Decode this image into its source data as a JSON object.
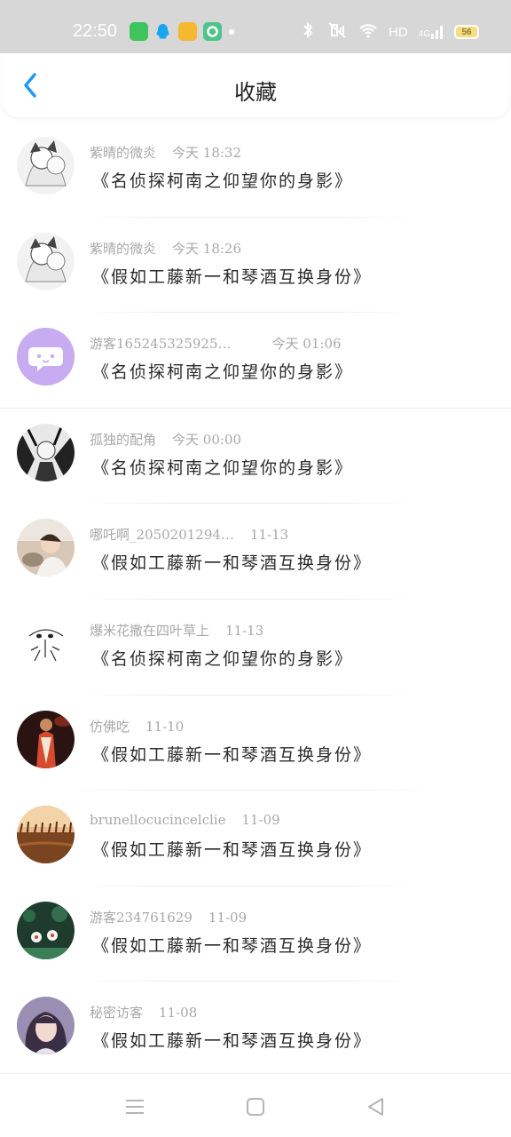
{
  "status": {
    "time": "22:50",
    "network": "HD",
    "signal": "4G",
    "battery": "56"
  },
  "header": {
    "title": "收藏"
  },
  "favorites": [
    {
      "user": "紫晴的微炎",
      "time": "今天 18:32",
      "title": "《名侦探柯南之仰望你的身影》",
      "avatar": "anime-sketch-avatar"
    },
    {
      "user": "紫晴的微炎",
      "time": "今天 18:26",
      "title": "《假如工藤新一和琴酒互换身份》",
      "avatar": "anime-sketch-avatar"
    },
    {
      "user": "游客165245325925…",
      "time": "今天 01:06",
      "title": "《名侦探柯南之仰望你的身影》",
      "avatar": "default-chat-avatar"
    },
    {
      "user": "孤独的配角",
      "time": "今天 00:00",
      "title": "《名侦探柯南之仰望你的身影》",
      "avatar": "anime-dark-avatar"
    },
    {
      "user": "哪吒啊_2050201294…",
      "time": "11-13",
      "title": "《假如工藤新一和琴酒互换身份》",
      "avatar": "photo-child-cat-avatar"
    },
    {
      "user": "爆米花撒在四叶草上",
      "time": "11-13",
      "title": "《名侦探柯南之仰望你的身影》",
      "avatar": "panda-doodle-avatar"
    },
    {
      "user": "仿佛吃",
      "time": "11-10",
      "title": "《假如工藤新一和琴酒互换身份》",
      "avatar": "game-character-avatar"
    },
    {
      "user": "brunellocucincelclie",
      "time": "11-09",
      "title": "《假如工藤新一和琴酒互换身份》",
      "avatar": "sunset-field-avatar"
    },
    {
      "user": "游客234761629",
      "time": "11-09",
      "title": "《假如工藤新一和琴酒互换身份》",
      "avatar": "flowers-avatar"
    },
    {
      "user": "秘密访客",
      "time": "11-08",
      "title": "《假如工藤新一和琴酒互换身份》",
      "avatar": "girl-photo-avatar"
    }
  ],
  "colors": {
    "statusbar": "#d7d7d7",
    "accent_blue": "#1e9bf0",
    "meta_gray": "#a8a8a8",
    "title_text": "#2b2b2b"
  }
}
